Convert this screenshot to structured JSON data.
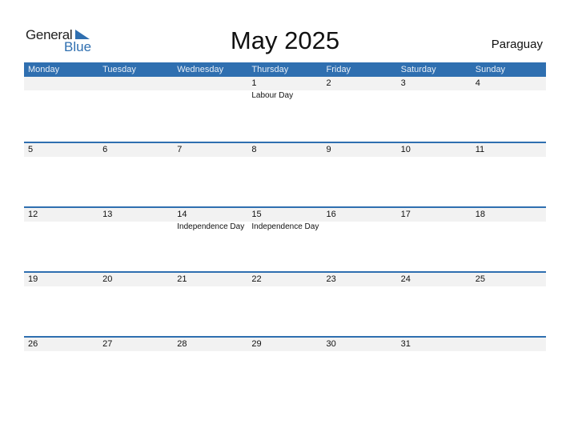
{
  "logo": {
    "general": "General",
    "blue": "Blue",
    "icon": "triangle-flag-icon"
  },
  "title": "May 2025",
  "country": "Paraguay",
  "colors": {
    "accent": "#2f6fb0",
    "band": "#f2f2f2"
  },
  "weekdays": [
    "Monday",
    "Tuesday",
    "Wednesday",
    "Thursday",
    "Friday",
    "Saturday",
    "Sunday"
  ],
  "weeks": [
    {
      "days": [
        "",
        "",
        "",
        "1",
        "2",
        "3",
        "4"
      ],
      "events": [
        "",
        "",
        "",
        "Labour Day",
        "",
        "",
        ""
      ]
    },
    {
      "days": [
        "5",
        "6",
        "7",
        "8",
        "9",
        "10",
        "11"
      ],
      "events": [
        "",
        "",
        "",
        "",
        "",
        "",
        ""
      ]
    },
    {
      "days": [
        "12",
        "13",
        "14",
        "15",
        "16",
        "17",
        "18"
      ],
      "events": [
        "",
        "",
        "Independence Day",
        "Independence Day",
        "",
        "",
        ""
      ]
    },
    {
      "days": [
        "19",
        "20",
        "21",
        "22",
        "23",
        "24",
        "25"
      ],
      "events": [
        "",
        "",
        "",
        "",
        "",
        "",
        ""
      ]
    },
    {
      "days": [
        "26",
        "27",
        "28",
        "29",
        "30",
        "31",
        ""
      ],
      "events": [
        "",
        "",
        "",
        "",
        "",
        "",
        ""
      ]
    }
  ]
}
